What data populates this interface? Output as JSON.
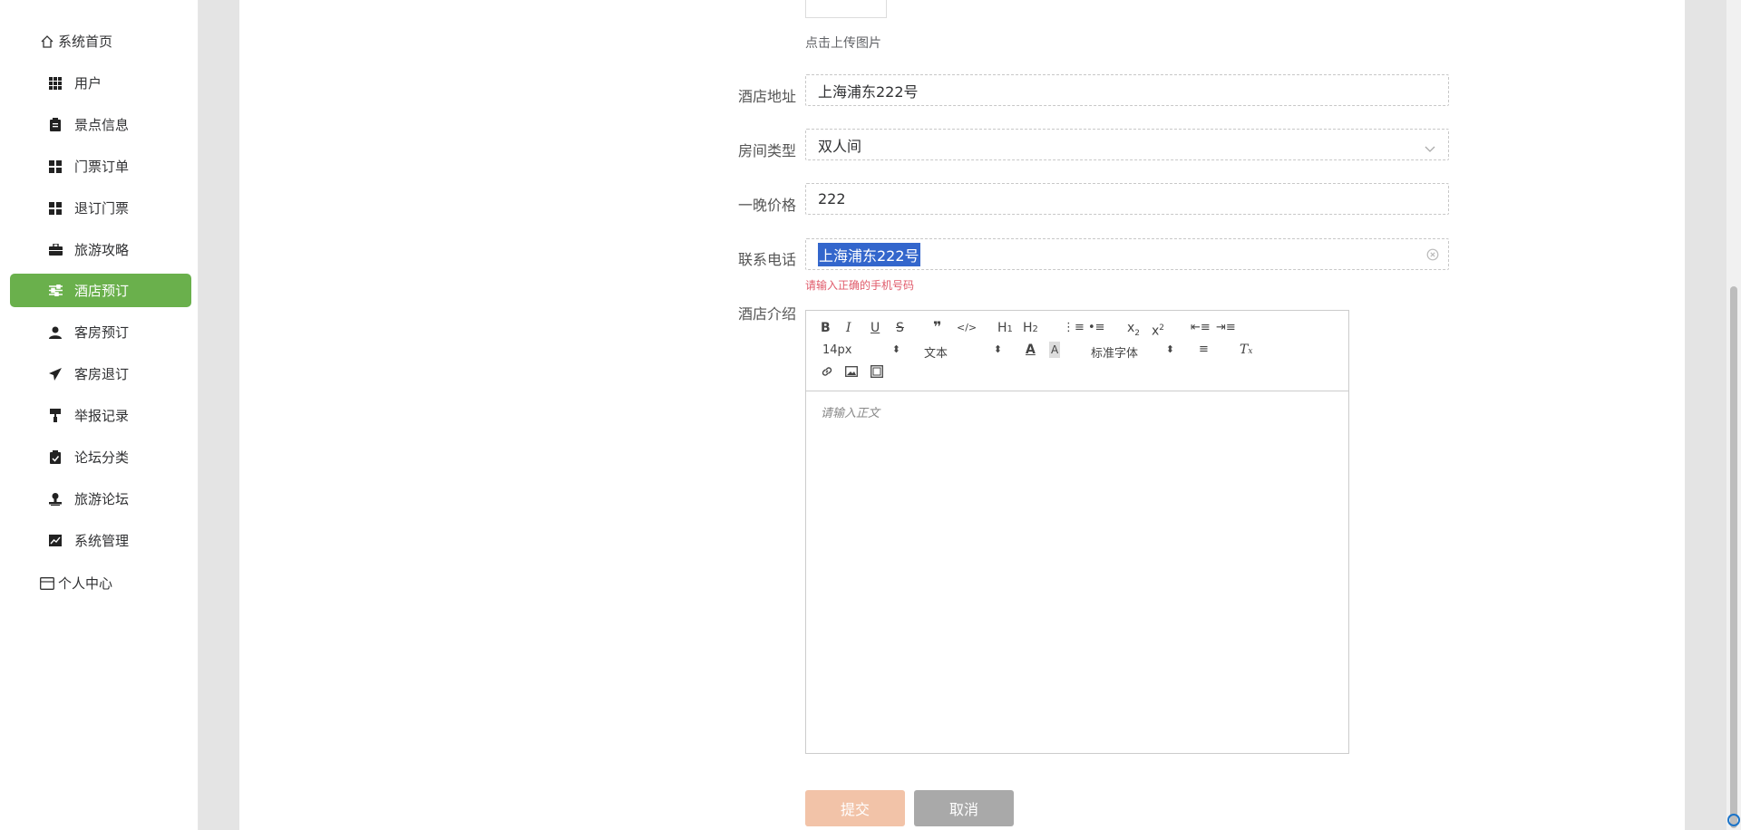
{
  "sidebar": {
    "items": [
      {
        "label": "系统首页",
        "icon": "home-icon"
      },
      {
        "label": "用户",
        "icon": "grid-icon"
      },
      {
        "label": "景点信息",
        "icon": "clipboard-icon"
      },
      {
        "label": "门票订单",
        "icon": "apps-icon"
      },
      {
        "label": "退订门票",
        "icon": "apps-icon"
      },
      {
        "label": "旅游攻略",
        "icon": "briefcase-icon"
      },
      {
        "label": "酒店预订",
        "icon": "sliders-icon"
      },
      {
        "label": "客房预订",
        "icon": "user-icon"
      },
      {
        "label": "客房退订",
        "icon": "send-icon"
      },
      {
        "label": "举报记录",
        "icon": "paint-roller-icon"
      },
      {
        "label": "论坛分类",
        "icon": "clipboard-check-icon"
      },
      {
        "label": "旅游论坛",
        "icon": "stamp-icon"
      },
      {
        "label": "系统管理",
        "icon": "chart-icon"
      },
      {
        "label": "个人中心",
        "icon": "id-card-icon"
      }
    ],
    "active_color": "#6ab04c"
  },
  "form": {
    "upload_hint": "点击上传图片",
    "address": {
      "label": "酒店地址",
      "value": "上海浦东222号"
    },
    "room_type": {
      "label": "房间类型",
      "value": "双人间"
    },
    "price": {
      "label": "一晚价格",
      "value": "222"
    },
    "phone": {
      "label": "联系电话",
      "value": "上海浦东222号",
      "error": "请输入正确的手机号码"
    },
    "intro": {
      "label": "酒店介绍"
    }
  },
  "editor": {
    "font_size": "14px",
    "text_style": "文本",
    "font_family": "标准字体",
    "placeholder": "请输入正文"
  },
  "buttons": {
    "submit": "提交",
    "cancel": "取消"
  }
}
